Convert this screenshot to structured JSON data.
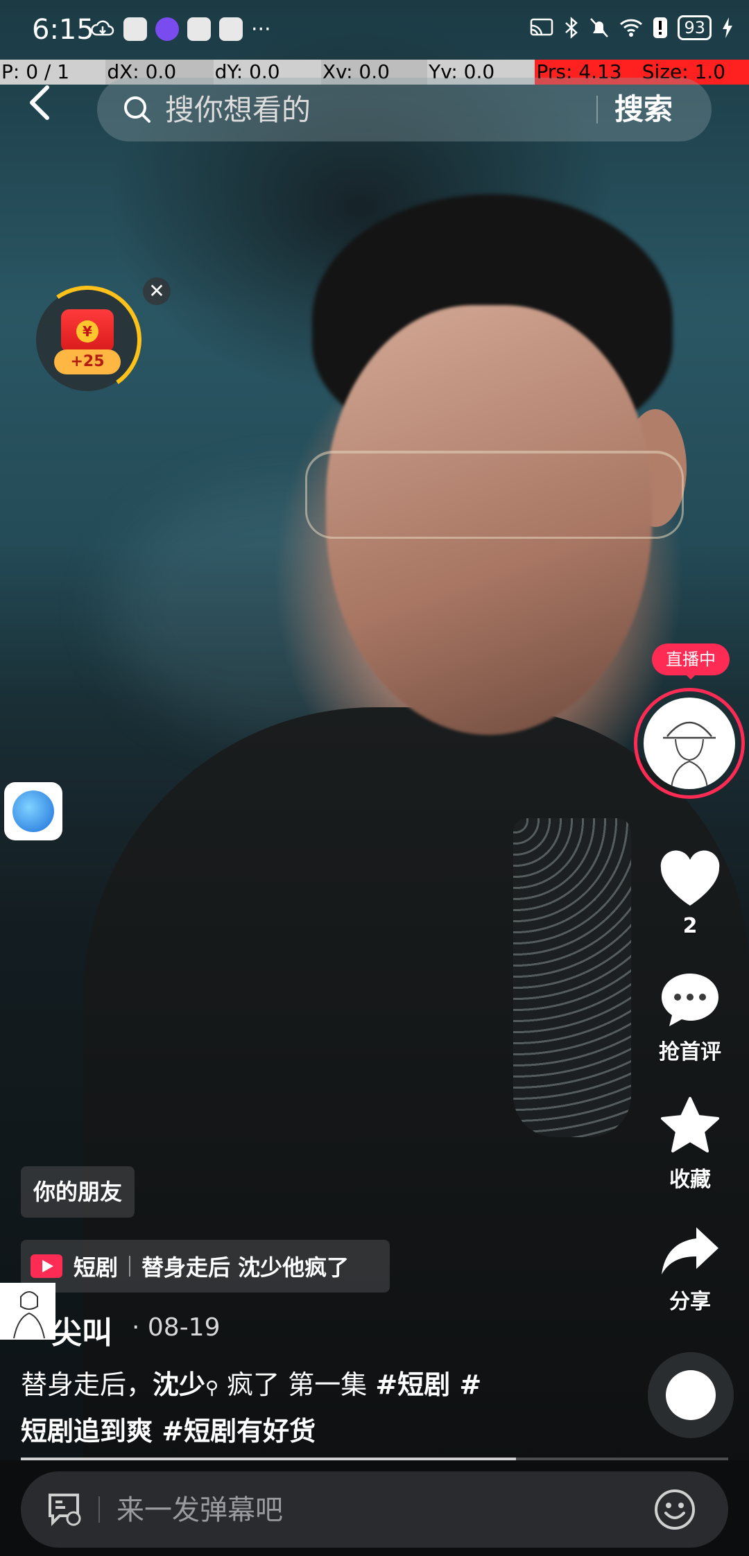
{
  "status_bar": {
    "time": "6:15",
    "battery": "93"
  },
  "debug_overlay": {
    "p": "P: 0 / 1",
    "dx": "dX: 0.0",
    "dy": "dY: 0.0",
    "xv": "Xv: 0.0",
    "yv": "Yv: 0.0",
    "prs": "Prs: 4.13",
    "size": "Size: 1.0"
  },
  "search": {
    "placeholder": "搜你想看的",
    "button_label": "搜索"
  },
  "red_packet": {
    "amount": "+25",
    "coin_symbol": "¥",
    "close": "✕"
  },
  "live": {
    "badge": "直播中"
  },
  "actions": {
    "like_count": "2",
    "comment_label": "抢首评",
    "favorite_label": "收藏",
    "share_label": "分享"
  },
  "video_info": {
    "friend_tag": "你的朋友",
    "drama_label": "短剧",
    "drama_title": "替身走后 沈少他疯了",
    "author": "尖叫",
    "date": "· 08-19",
    "desc_part1": "替身走后，",
    "desc_bold": "沈少",
    "desc_part2": " 疯了 第一集 ",
    "hashtag1": "#短剧 #",
    "line2": "短剧追到爽 #短剧有好货",
    "progress": 0.7
  },
  "comment_bar": {
    "placeholder": "来一发弹幕吧"
  },
  "colors": {
    "accent": "#fe2c55",
    "gold": "#ffc21a"
  },
  "icons": [
    "back-icon",
    "search-icon",
    "heart-icon",
    "comment-icon",
    "star-icon",
    "share-icon",
    "danmaku-icon",
    "emoji-icon"
  ]
}
